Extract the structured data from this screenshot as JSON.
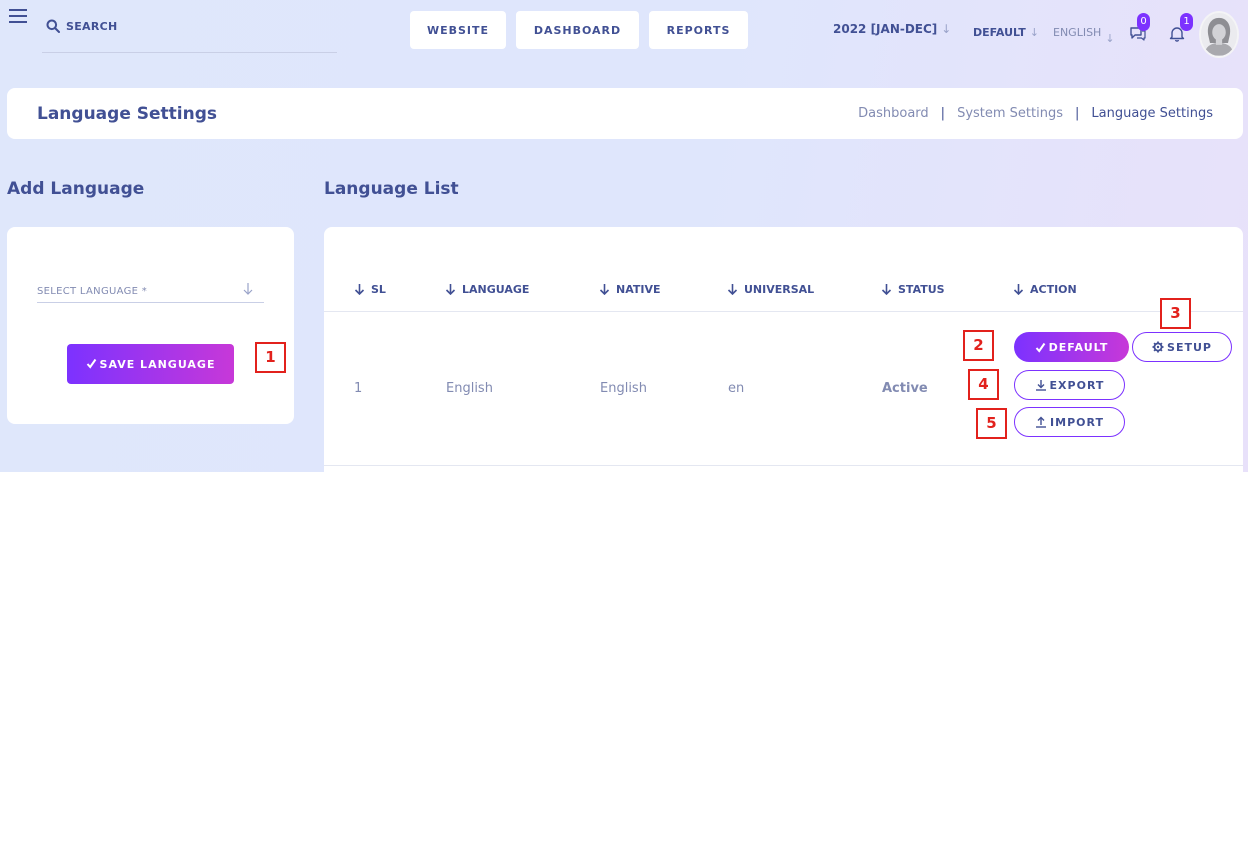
{
  "topbar": {
    "search_placeholder": "SEARCH",
    "nav_buttons": [
      "WEBSITE",
      "DASHBOARD",
      "REPORTS"
    ],
    "session": "2022 [JAN-DEC]",
    "style": "DEFAULT",
    "language": "ENGLISH",
    "chat_badge": "0",
    "notification_badge": "1"
  },
  "header": {
    "title": "Language Settings",
    "breadcrumb": [
      "Dashboard",
      "System Settings",
      "Language Settings"
    ]
  },
  "add_language": {
    "title": "Add Language",
    "select_placeholder": "SELECT LANGUAGE *",
    "save_label": "SAVE LANGUAGE"
  },
  "language_list": {
    "title": "Language List",
    "columns": [
      "SL",
      "LANGUAGE",
      "NATIVE",
      "UNIVERSAL",
      "STATUS",
      "ACTION"
    ],
    "rows": [
      {
        "sl": "1",
        "language": "English",
        "native": "English",
        "universal": "en",
        "status": "Active"
      }
    ],
    "actions": {
      "default": "DEFAULT",
      "setup": "SETUP",
      "export": "EXPORT",
      "import": "IMPORT"
    }
  },
  "markers": [
    "1",
    "2",
    "3",
    "4",
    "5"
  ],
  "colors": {
    "primary": "#7c32ff",
    "secondary": "#c738d8",
    "text": "#415094",
    "muted": "#828bb2",
    "marker": "#e2211c"
  }
}
